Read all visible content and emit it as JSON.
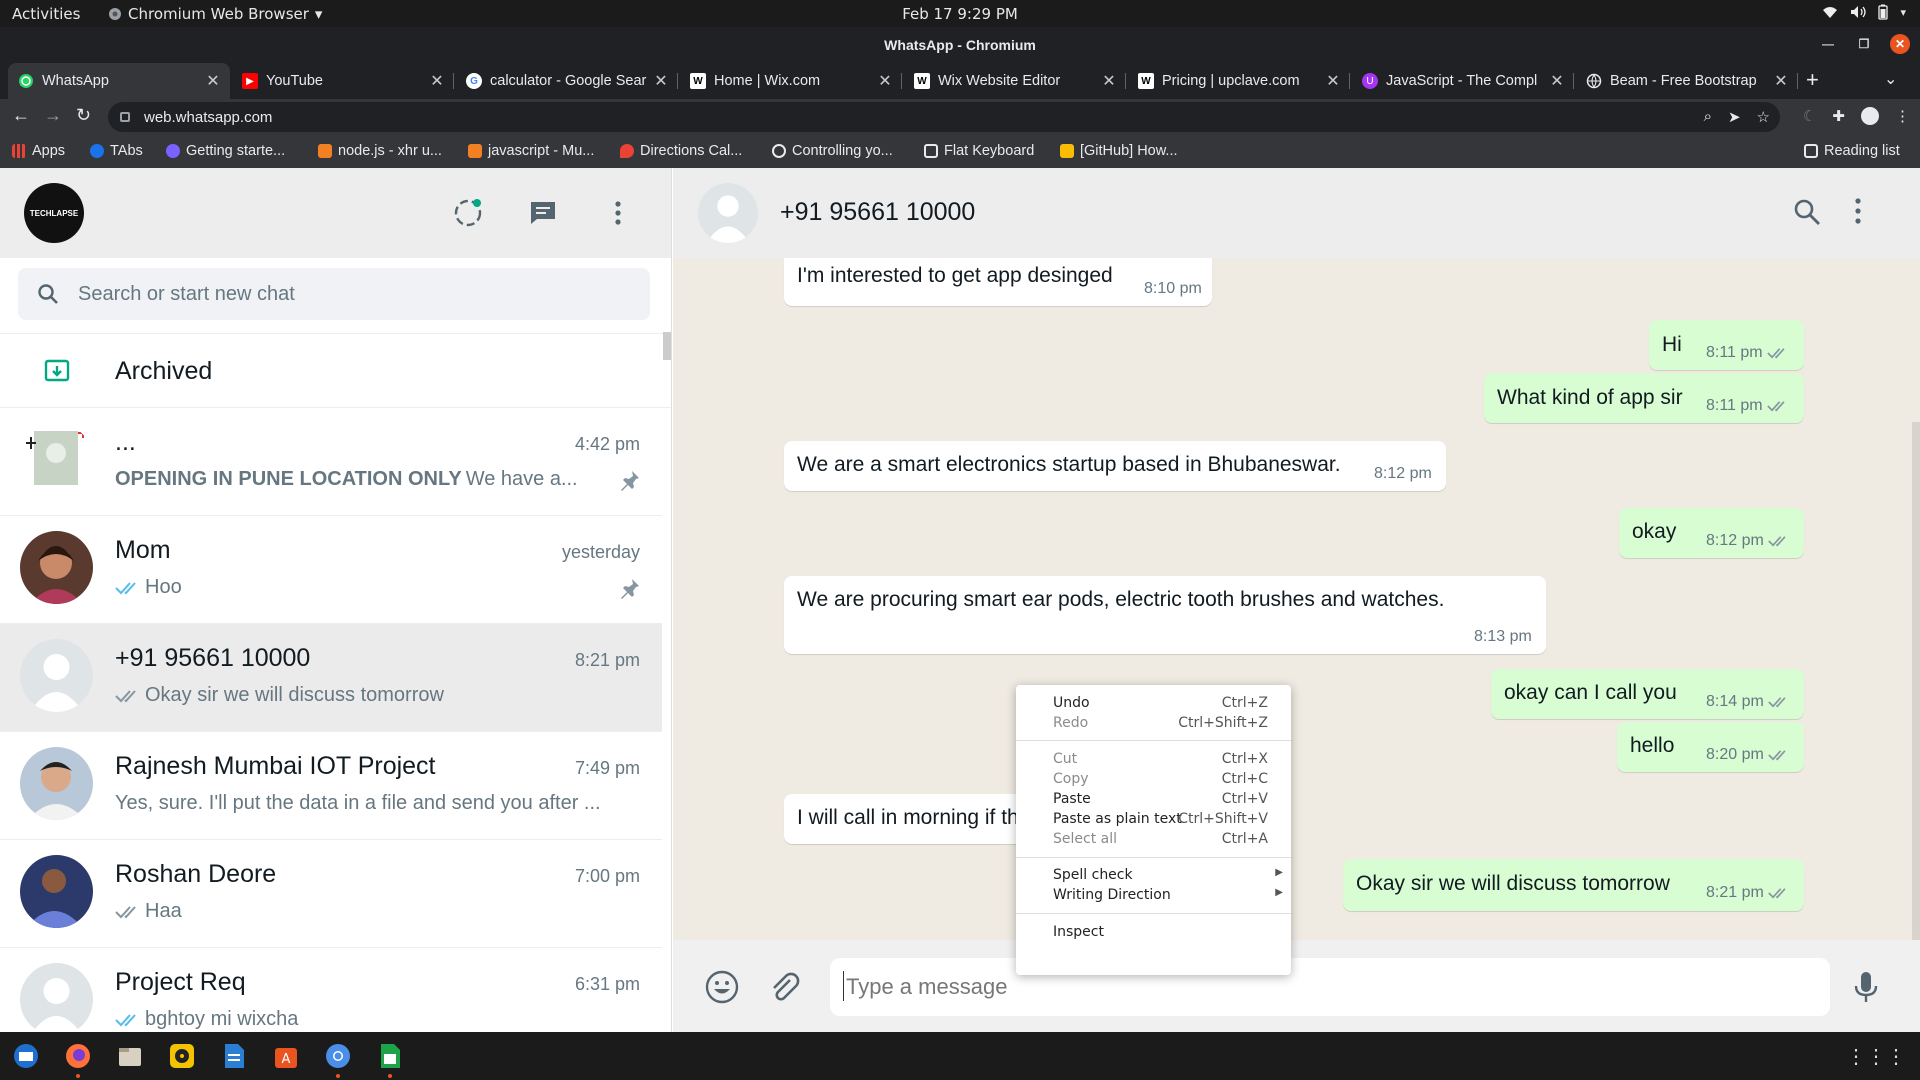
{
  "os": {
    "activities": "Activities",
    "app_menu": "Chromium Web Browser",
    "clock": "Feb 17  9:29 PM"
  },
  "window": {
    "title": "WhatsApp - Chromium"
  },
  "tabs": [
    {
      "label": "WhatsApp",
      "icon": "whatsapp-icon",
      "color": "#25d366"
    },
    {
      "label": "YouTube",
      "icon": "youtube-icon",
      "color": "#ff0000"
    },
    {
      "label": "calculator - Google Sear",
      "icon": "google-icon",
      "color": "#4285f4"
    },
    {
      "label": "Home | Wix.com",
      "icon": "wix-icon",
      "color": "#ffffff"
    },
    {
      "label": "Wix Website Editor",
      "icon": "wix-icon",
      "color": "#ffffff"
    },
    {
      "label": "Pricing | upclave.com",
      "icon": "wix-icon",
      "color": "#ffffff"
    },
    {
      "label": "JavaScript - The Compl",
      "icon": "udemy-icon",
      "color": "#a435f0"
    },
    {
      "label": "Beam - Free Bootstrap",
      "icon": "globe-icon",
      "color": "#ffffff"
    }
  ],
  "url": "web.whatsapp.com",
  "bookmarks": [
    {
      "label": "Apps",
      "color": "#ea4335"
    },
    {
      "label": "TAbs",
      "color": "#1a73e8"
    },
    {
      "label": "Getting starte...",
      "color": "#7b61ff"
    },
    {
      "label": "node.js - xhr u...",
      "color": "#f48024"
    },
    {
      "label": "javascript - Mu...",
      "color": "#f48024"
    },
    {
      "label": "Directions Cal...",
      "color": "#ea4335"
    },
    {
      "label": "Controlling yo...",
      "color": "#ffffff"
    },
    {
      "label": "Flat Keyboard",
      "color": "#ffffff"
    },
    {
      "label": "[GitHub] How...",
      "color": "#fbbc04"
    }
  ],
  "reading_list": "Reading list",
  "sidebar": {
    "profile_label": "TECHLAPSE",
    "search_placeholder": "Search or start new chat",
    "archived": "Archived",
    "chats": [
      {
        "name": "...",
        "time": "4:42 pm",
        "bold": "OPENING IN PUNE LOCATION ONLY",
        "msg": " We have a...",
        "ticks": false,
        "pinned": true
      },
      {
        "name": "Mom",
        "time": "yesterday",
        "msg": "Hoo",
        "ticks": "blue",
        "pinned": true
      },
      {
        "name": "+91 95661 10000",
        "time": "8:21 pm",
        "msg": "Okay sir we will discuss tomorrow",
        "ticks": "grey",
        "pinned": false,
        "selected": true
      },
      {
        "name": "Rajnesh Mumbai IOT Project",
        "time": "7:49 pm",
        "msg": "Yes, sure. I'll put the data in a file and send you after ...",
        "ticks": false,
        "pinned": false
      },
      {
        "name": "Roshan Deore",
        "time": "7:00 pm",
        "msg": "Haa",
        "ticks": "grey",
        "pinned": false
      },
      {
        "name": "Project Req",
        "time": "6:31 pm",
        "msg": "bghtoy mi wixcha",
        "ticks": "blue",
        "pinned": false
      }
    ]
  },
  "conversation": {
    "title": "+91 95661 10000",
    "messages": [
      {
        "dir": "in",
        "text": "I'm interested to get app desinged",
        "time": "8:10 pm"
      },
      {
        "dir": "out",
        "text": "Hi",
        "time": "8:11 pm"
      },
      {
        "dir": "out",
        "text": "What kind of app sir",
        "time": "8:11 pm"
      },
      {
        "dir": "in",
        "text": "We are a smart electronics startup based in Bhubaneswar.",
        "time": "8:12 pm"
      },
      {
        "dir": "out",
        "text": "okay",
        "time": "8:12 pm"
      },
      {
        "dir": "in",
        "text": "We are procuring smart ear pods, electric tooth brushes and watches.",
        "time": "8:13 pm"
      },
      {
        "dir": "out",
        "text": "okay can I call you",
        "time": "8:14 pm"
      },
      {
        "dir": "out",
        "text": "hello",
        "time": "8:20 pm"
      },
      {
        "dir": "in",
        "text": "I will call in morning if th",
        "time": ""
      },
      {
        "dir": "out",
        "text": "Okay sir we will discuss tomorrow",
        "time": "8:21 pm"
      }
    ],
    "input_placeholder": "Type a message"
  },
  "context_menu": [
    {
      "label": "Undo",
      "shortcut": "Ctrl+Z",
      "enabled": true
    },
    {
      "label": "Redo",
      "shortcut": "Ctrl+Shift+Z",
      "enabled": false
    },
    {
      "label": "Cut",
      "shortcut": "Ctrl+X",
      "enabled": false
    },
    {
      "label": "Copy",
      "shortcut": "Ctrl+C",
      "enabled": false
    },
    {
      "label": "Paste",
      "shortcut": "Ctrl+V",
      "enabled": true
    },
    {
      "label": "Paste as plain text",
      "shortcut": "Ctrl+Shift+V",
      "enabled": true
    },
    {
      "label": "Select all",
      "shortcut": "Ctrl+A",
      "enabled": false
    },
    {
      "label": "Spell check",
      "shortcut": "",
      "enabled": true,
      "submenu": true
    },
    {
      "label": "Writing Direction",
      "shortcut": "",
      "enabled": true,
      "submenu": true
    },
    {
      "label": "Inspect",
      "shortcut": "",
      "enabled": true
    }
  ],
  "colors": {
    "accent": "#00a884",
    "blue_tick": "#53bdeb",
    "outgoing_bubble": "#d9fdd3",
    "chat_bg": "#efeae2"
  },
  "dock_apps": [
    {
      "name": "thunderbird-icon",
      "color": "#1f6fd0"
    },
    {
      "name": "firefox-icon",
      "color": "#ff7139"
    },
    {
      "name": "files-icon",
      "color": "#c8c0b0"
    },
    {
      "name": "rhythmbox-icon",
      "color": "#f3c200"
    },
    {
      "name": "writer-icon",
      "color": "#2a7fd4"
    },
    {
      "name": "software-icon",
      "color": "#e95420"
    },
    {
      "name": "chromium-icon",
      "color": "#4a8fe7"
    },
    {
      "name": "calc-icon",
      "color": "#1fa34a"
    }
  ]
}
